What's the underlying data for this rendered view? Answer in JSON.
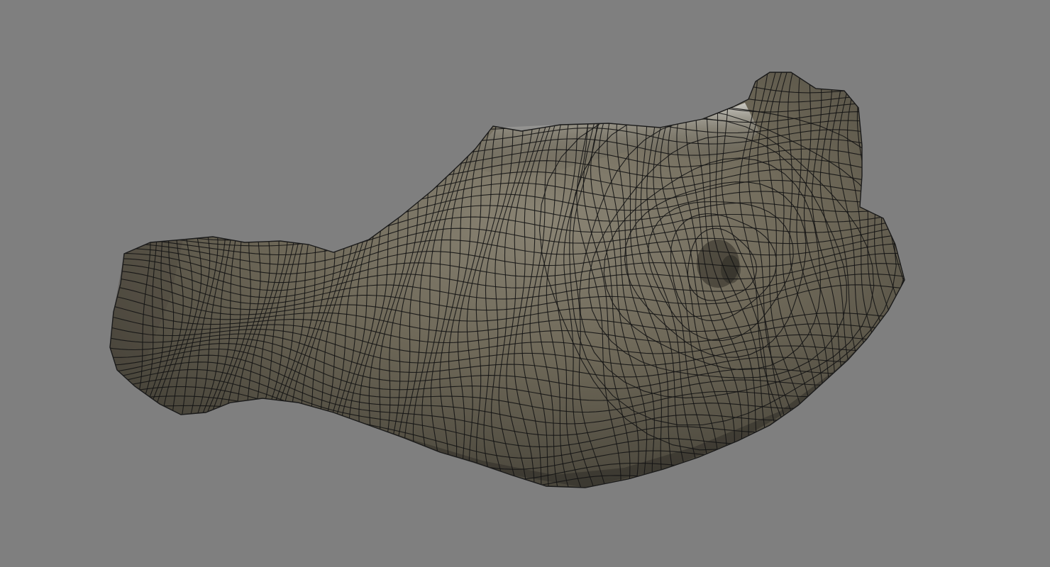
{
  "viewport": {
    "background_color": "#7f7f7f"
  },
  "model": {
    "kind": "rock",
    "display_mode": "wireframe-on-shaded",
    "surface_color": "#6b6658",
    "highlight_color": "#d6d6d2",
    "shadow_color": "#3e3b33",
    "wire_color": "#141414"
  }
}
